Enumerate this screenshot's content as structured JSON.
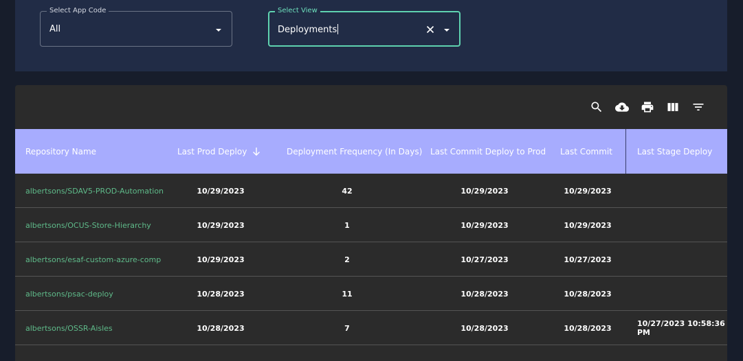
{
  "filters": {
    "app_code": {
      "label": "Select App Code",
      "value": "All"
    },
    "view": {
      "label": "Select View",
      "value": "Deployments"
    }
  },
  "toolbar": {
    "icons": [
      "search-icon",
      "cloud-download-icon",
      "print-icon",
      "view-columns-icon",
      "filter-list-icon"
    ]
  },
  "table": {
    "columns": [
      "Repository Name",
      "Last Prod Deploy",
      "Deployment Frequency (In Days)",
      "Last Commit Deploy to Prod",
      "Last Commit",
      "Last Stage Deploy"
    ],
    "rows": [
      {
        "repo": "albertsons/SDAV5-PROD-Automation",
        "last_prod": "10/29/2023",
        "freq": "42",
        "commit_prod": "10/29/2023",
        "last_commit": "10/29/2023",
        "stage": ""
      },
      {
        "repo": "albertsons/OCUS-Store-Hierarchy",
        "last_prod": "10/29/2023",
        "freq": "1",
        "commit_prod": "10/29/2023",
        "last_commit": "10/29/2023",
        "stage": ""
      },
      {
        "repo": "albertsons/esaf-custom-azure-comp",
        "last_prod": "10/29/2023",
        "freq": "2",
        "commit_prod": "10/27/2023",
        "last_commit": "10/27/2023",
        "stage": ""
      },
      {
        "repo": "albertsons/psac-deploy",
        "last_prod": "10/28/2023",
        "freq": "11",
        "commit_prod": "10/28/2023",
        "last_commit": "10/28/2023",
        "stage": ""
      },
      {
        "repo": "albertsons/OSSR-Aisles",
        "last_prod": "10/28/2023",
        "freq": "7",
        "commit_prod": "10/28/2023",
        "last_commit": "10/28/2023",
        "stage": "10/27/2023 10:58:36 PM"
      }
    ]
  },
  "colors": {
    "header_bg": "#a7acfe",
    "accent": "#5fd3b0",
    "link": "#5fbb8a",
    "panel_bg": "#212c46",
    "table_bg": "#2b2b2b"
  }
}
